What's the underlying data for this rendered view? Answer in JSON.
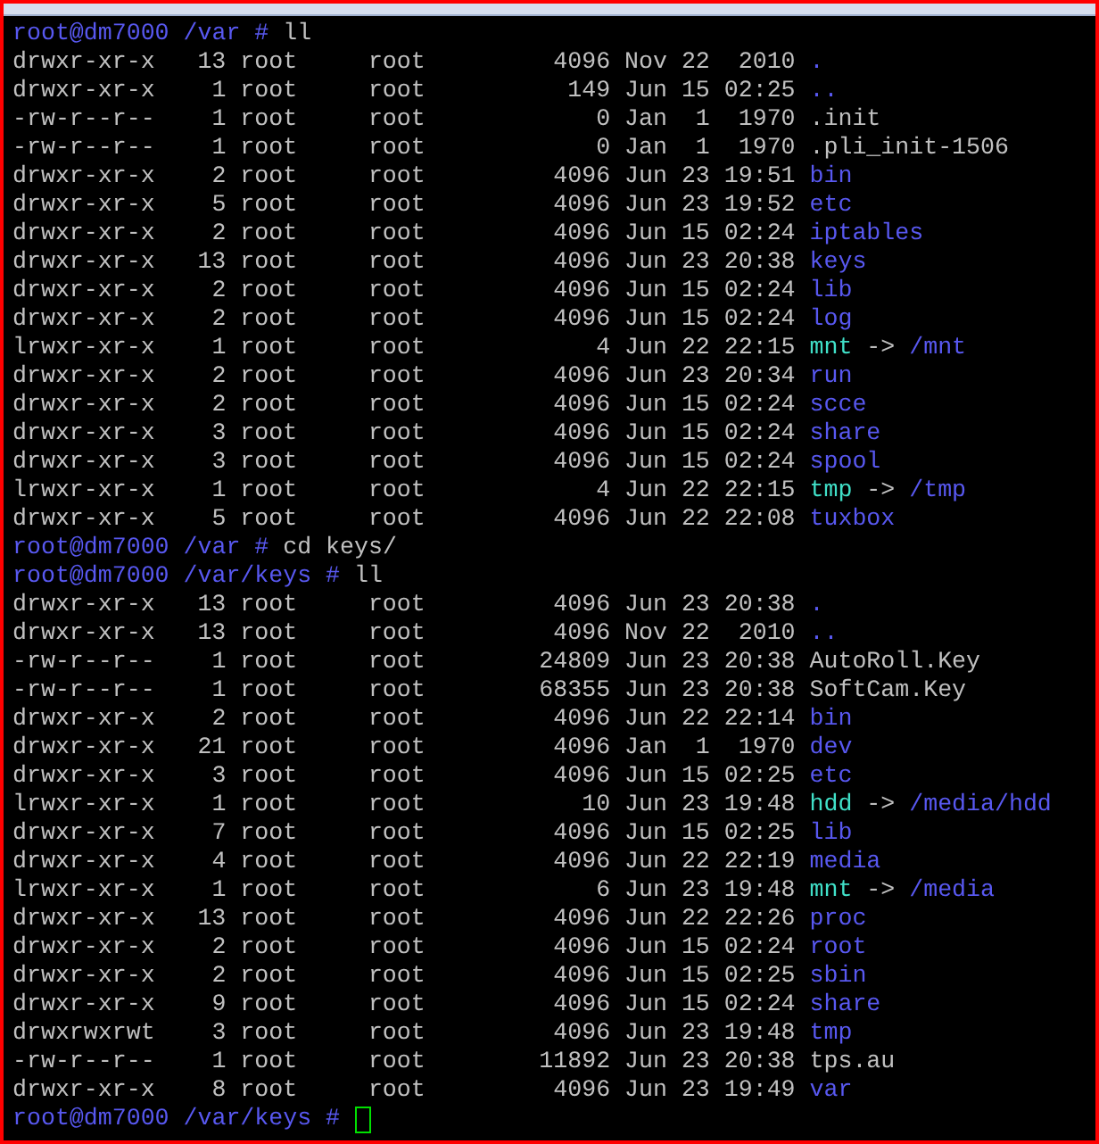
{
  "lines": [
    {
      "kind": "prompt",
      "prompt": "root@dm7000 /var #",
      "command": "ll"
    },
    {
      "kind": "dir",
      "perms": "drwxr-xr-x",
      "links": "13",
      "owner": "root",
      "group": "root",
      "size": "4096",
      "date": "Nov 22  2010",
      "name": "."
    },
    {
      "kind": "dir",
      "perms": "drwxr-xr-x",
      "links": "1",
      "owner": "root",
      "group": "root",
      "size": "149",
      "date": "Jun 15 02:25",
      "name": ".."
    },
    {
      "kind": "file",
      "perms": "-rw-r--r--",
      "links": "1",
      "owner": "root",
      "group": "root",
      "size": "0",
      "date": "Jan  1  1970",
      "name": ".init"
    },
    {
      "kind": "file",
      "perms": "-rw-r--r--",
      "links": "1",
      "owner": "root",
      "group": "root",
      "size": "0",
      "date": "Jan  1  1970",
      "name": ".pli_init-1506"
    },
    {
      "kind": "dir",
      "perms": "drwxr-xr-x",
      "links": "2",
      "owner": "root",
      "group": "root",
      "size": "4096",
      "date": "Jun 23 19:51",
      "name": "bin"
    },
    {
      "kind": "dir",
      "perms": "drwxr-xr-x",
      "links": "5",
      "owner": "root",
      "group": "root",
      "size": "4096",
      "date": "Jun 23 19:52",
      "name": "etc"
    },
    {
      "kind": "dir",
      "perms": "drwxr-xr-x",
      "links": "2",
      "owner": "root",
      "group": "root",
      "size": "4096",
      "date": "Jun 15 02:24",
      "name": "iptables"
    },
    {
      "kind": "dir",
      "perms": "drwxr-xr-x",
      "links": "13",
      "owner": "root",
      "group": "root",
      "size": "4096",
      "date": "Jun 23 20:38",
      "name": "keys"
    },
    {
      "kind": "dir",
      "perms": "drwxr-xr-x",
      "links": "2",
      "owner": "root",
      "group": "root",
      "size": "4096",
      "date": "Jun 15 02:24",
      "name": "lib"
    },
    {
      "kind": "dir",
      "perms": "drwxr-xr-x",
      "links": "2",
      "owner": "root",
      "group": "root",
      "size": "4096",
      "date": "Jun 15 02:24",
      "name": "log"
    },
    {
      "kind": "link",
      "perms": "lrwxr-xr-x",
      "links": "1",
      "owner": "root",
      "group": "root",
      "size": "4",
      "date": "Jun 22 22:15",
      "name": "mnt",
      "arrow": "->",
      "target": "/mnt"
    },
    {
      "kind": "dir",
      "perms": "drwxr-xr-x",
      "links": "2",
      "owner": "root",
      "group": "root",
      "size": "4096",
      "date": "Jun 23 20:34",
      "name": "run"
    },
    {
      "kind": "dir",
      "perms": "drwxr-xr-x",
      "links": "2",
      "owner": "root",
      "group": "root",
      "size": "4096",
      "date": "Jun 15 02:24",
      "name": "scce"
    },
    {
      "kind": "dir",
      "perms": "drwxr-xr-x",
      "links": "3",
      "owner": "root",
      "group": "root",
      "size": "4096",
      "date": "Jun 15 02:24",
      "name": "share"
    },
    {
      "kind": "dir",
      "perms": "drwxr-xr-x",
      "links": "3",
      "owner": "root",
      "group": "root",
      "size": "4096",
      "date": "Jun 15 02:24",
      "name": "spool"
    },
    {
      "kind": "link",
      "perms": "lrwxr-xr-x",
      "links": "1",
      "owner": "root",
      "group": "root",
      "size": "4",
      "date": "Jun 22 22:15",
      "name": "tmp",
      "arrow": "->",
      "target": "/tmp"
    },
    {
      "kind": "dir",
      "perms": "drwxr-xr-x",
      "links": "5",
      "owner": "root",
      "group": "root",
      "size": "4096",
      "date": "Jun 22 22:08",
      "name": "tuxbox"
    },
    {
      "kind": "prompt",
      "prompt": "root@dm7000 /var #",
      "command": "cd keys/"
    },
    {
      "kind": "prompt",
      "prompt": "root@dm7000 /var/keys #",
      "command": "ll"
    },
    {
      "kind": "dir",
      "perms": "drwxr-xr-x",
      "links": "13",
      "owner": "root",
      "group": "root",
      "size": "4096",
      "date": "Jun 23 20:38",
      "name": "."
    },
    {
      "kind": "dir",
      "perms": "drwxr-xr-x",
      "links": "13",
      "owner": "root",
      "group": "root",
      "size": "4096",
      "date": "Nov 22  2010",
      "name": ".."
    },
    {
      "kind": "file",
      "perms": "-rw-r--r--",
      "links": "1",
      "owner": "root",
      "group": "root",
      "size": "24809",
      "date": "Jun 23 20:38",
      "name": "AutoRoll.Key"
    },
    {
      "kind": "file",
      "perms": "-rw-r--r--",
      "links": "1",
      "owner": "root",
      "group": "root",
      "size": "68355",
      "date": "Jun 23 20:38",
      "name": "SoftCam.Key"
    },
    {
      "kind": "dir",
      "perms": "drwxr-xr-x",
      "links": "2",
      "owner": "root",
      "group": "root",
      "size": "4096",
      "date": "Jun 22 22:14",
      "name": "bin"
    },
    {
      "kind": "dir",
      "perms": "drwxr-xr-x",
      "links": "21",
      "owner": "root",
      "group": "root",
      "size": "4096",
      "date": "Jan  1  1970",
      "name": "dev"
    },
    {
      "kind": "dir",
      "perms": "drwxr-xr-x",
      "links": "3",
      "owner": "root",
      "group": "root",
      "size": "4096",
      "date": "Jun 15 02:25",
      "name": "etc"
    },
    {
      "kind": "link",
      "perms": "lrwxr-xr-x",
      "links": "1",
      "owner": "root",
      "group": "root",
      "size": "10",
      "date": "Jun 23 19:48",
      "name": "hdd",
      "arrow": "->",
      "target": "/media/hdd"
    },
    {
      "kind": "dir",
      "perms": "drwxr-xr-x",
      "links": "7",
      "owner": "root",
      "group": "root",
      "size": "4096",
      "date": "Jun 15 02:25",
      "name": "lib"
    },
    {
      "kind": "dir",
      "perms": "drwxr-xr-x",
      "links": "4",
      "owner": "root",
      "group": "root",
      "size": "4096",
      "date": "Jun 22 22:19",
      "name": "media"
    },
    {
      "kind": "link",
      "perms": "lrwxr-xr-x",
      "links": "1",
      "owner": "root",
      "group": "root",
      "size": "6",
      "date": "Jun 23 19:48",
      "name": "mnt",
      "arrow": "->",
      "target": "/media"
    },
    {
      "kind": "dir",
      "perms": "drwxr-xr-x",
      "links": "13",
      "owner": "root",
      "group": "root",
      "size": "4096",
      "date": "Jun 22 22:26",
      "name": "proc"
    },
    {
      "kind": "dir",
      "perms": "drwxr-xr-x",
      "links": "2",
      "owner": "root",
      "group": "root",
      "size": "4096",
      "date": "Jun 15 02:24",
      "name": "root"
    },
    {
      "kind": "dir",
      "perms": "drwxr-xr-x",
      "links": "2",
      "owner": "root",
      "group": "root",
      "size": "4096",
      "date": "Jun 15 02:25",
      "name": "sbin"
    },
    {
      "kind": "dir",
      "perms": "drwxr-xr-x",
      "links": "9",
      "owner": "root",
      "group": "root",
      "size": "4096",
      "date": "Jun 15 02:24",
      "name": "share"
    },
    {
      "kind": "dir",
      "perms": "drwxrwxrwt",
      "links": "3",
      "owner": "root",
      "group": "root",
      "size": "4096",
      "date": "Jun 23 19:48",
      "name": "tmp"
    },
    {
      "kind": "file",
      "perms": "-rw-r--r--",
      "links": "1",
      "owner": "root",
      "group": "root",
      "size": "11892",
      "date": "Jun 23 20:38",
      "name": "tps.au"
    },
    {
      "kind": "dir",
      "perms": "drwxr-xr-x",
      "links": "8",
      "owner": "root",
      "group": "root",
      "size": "4096",
      "date": "Jun 23 19:49",
      "name": "var"
    },
    {
      "kind": "prompt",
      "prompt": "root@dm7000 /var/keys #",
      "cursor": true
    }
  ]
}
